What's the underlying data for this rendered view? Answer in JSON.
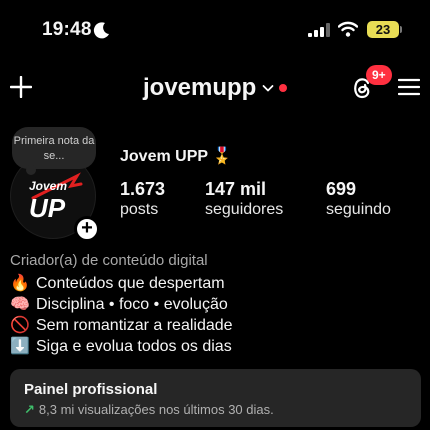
{
  "status_bar": {
    "time": "19:48",
    "battery": "23"
  },
  "header": {
    "username": "jovemupp",
    "notif_badge": "9+"
  },
  "profile": {
    "note": "Primeira nota da se...",
    "display_name": "Jovem UPP",
    "display_emoji": "🎖️",
    "avatar_text_top": "Jovem",
    "avatar_text_main": "UP"
  },
  "stats": [
    {
      "value": "1.673",
      "label": "posts"
    },
    {
      "value": "147 mil",
      "label": "seguidores"
    },
    {
      "value": "699",
      "label": "seguindo"
    }
  ],
  "bio": {
    "category": "Criador(a) de conteúdo digital",
    "lines": [
      {
        "emoji": "🔥",
        "text": "Conteúdos que despertam"
      },
      {
        "emoji": "🧠",
        "text": "Disciplina • foco • evolução"
      },
      {
        "emoji": "🚫",
        "text": "Sem romantizar a realidade"
      },
      {
        "emoji": "⬇️",
        "text": "Siga e evolua todos os dias"
      }
    ]
  },
  "pro_panel": {
    "title": "Painel profissional",
    "arrow": "↗",
    "subtitle": "8,3 mi visualizações nos últimos 30 dias."
  },
  "colors": {
    "accent_red": "#ff3040",
    "battery": "#e8dd55",
    "trend_green": "#3fbf6b"
  }
}
